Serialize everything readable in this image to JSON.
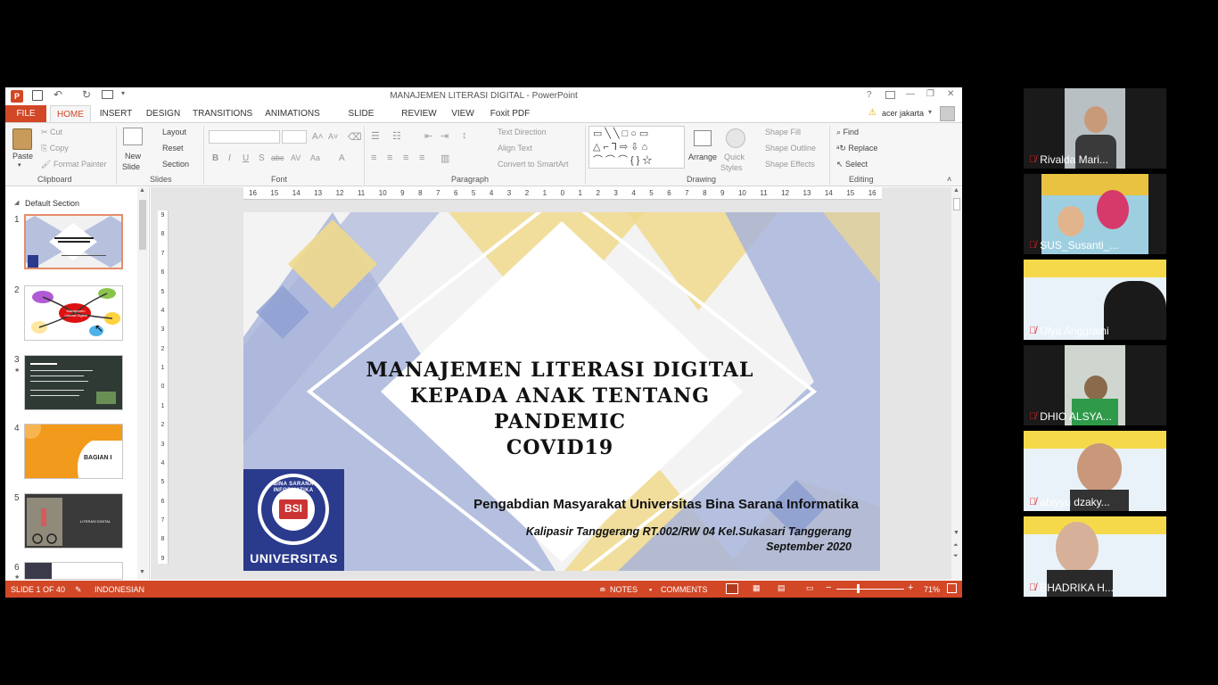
{
  "window": {
    "title": "MANAJEMEN LITERASI DIGITAL - PowerPoint",
    "user": "acer jakarta",
    "help": "?",
    "minimize": "—",
    "restore": "❐",
    "close": "✕"
  },
  "tabs": [
    "FILE",
    "HOME",
    "INSERT",
    "DESIGN",
    "TRANSITIONS",
    "ANIMATIONS",
    "SLIDE SHOW",
    "REVIEW",
    "VIEW",
    "Foxit PDF"
  ],
  "ribbon": {
    "clipboard": {
      "paste": "Paste",
      "cut": "Cut",
      "copy": "Copy",
      "format_painter": "Format Painter",
      "group": "Clipboard"
    },
    "slides": {
      "new_slide_1": "New",
      "new_slide_2": "Slide",
      "layout": "Layout",
      "reset": "Reset",
      "section": "Section",
      "group": "Slides"
    },
    "font": {
      "group": "Font",
      "bold": "B",
      "italic": "I",
      "underline": "U",
      "strike": "S",
      "abc": "abc",
      "spacing": "AV",
      "case": "Aa",
      "color": "A"
    },
    "paragraph": {
      "group": "Paragraph",
      "text_direction": "Text Direction",
      "align_text": "Align Text",
      "smartart": "Convert to SmartArt"
    },
    "drawing": {
      "arrange": "Arrange",
      "quick_styles_1": "Quick",
      "quick_styles_2": "Styles",
      "shape_fill": "Shape Fill",
      "shape_outline": "Shape Outline",
      "shape_effects": "Shape Effects",
      "group": "Drawing"
    },
    "editing": {
      "find": "Find",
      "replace": "Replace",
      "select": "Select",
      "group": "Editing"
    }
  },
  "left_pane": {
    "section": "Default Section",
    "slide_numbers": [
      "1",
      "2",
      "3",
      "4",
      "5",
      "6"
    ],
    "thumb2_label": "Manajemen Literasi Digital",
    "thumb4_label": "BAGIAN I",
    "thumb5_label": "LITERASI DIGITAL"
  },
  "slide": {
    "title_1": "MANAJEMEN LITERASI DIGITAL",
    "title_2": "KEPADA ANAK TENTANG PANDEMIC",
    "title_3": "COVID19",
    "subtitle": "Pengabdian Masyarakat Universitas Bina Sarana Informatika",
    "address": "Kalipasir Tanggerang RT.002/RW 04 Kel.Sukasari Tanggerang",
    "date": "September 2020",
    "logo_text": "UNIVERSITAS",
    "logo_ring": "BINA SARANA INFORMATIKA",
    "logo_mark": "BSI"
  },
  "ruler": {
    "h_ticks": [
      "16",
      "15",
      "14",
      "13",
      "12",
      "11",
      "10",
      "9",
      "8",
      "7",
      "6",
      "5",
      "4",
      "3",
      "2",
      "1",
      "0",
      "1",
      "2",
      "3",
      "4",
      "5",
      "6",
      "7",
      "8",
      "9",
      "10",
      "11",
      "12",
      "13",
      "14",
      "15",
      "16"
    ],
    "v_ticks": [
      "9",
      "8",
      "7",
      "6",
      "5",
      "4",
      "3",
      "2",
      "1",
      "0",
      "1",
      "2",
      "3",
      "4",
      "5",
      "6",
      "7",
      "8",
      "9"
    ]
  },
  "statusbar": {
    "slide": "SLIDE 1 OF 40",
    "language": "INDONESIAN",
    "notes": "NOTES",
    "comments": "COMMENTS",
    "zoom": "71%"
  },
  "participants": [
    {
      "name": "Rivalda Mari..."
    },
    {
      "name": "SUS_Susanti_..."
    },
    {
      "name": "Ulya Anggraini"
    },
    {
      "name": "DHIO ALSYA..."
    },
    {
      "name": "abiyyu dzaky..."
    },
    {
      "name": "BHADRIKA H..."
    }
  ],
  "colors": {
    "ppt_accent": "#d24726",
    "slide_blue": "#a9b5da",
    "slide_yellow": "#f0d98c",
    "logo_blue": "#2a3a8c"
  }
}
